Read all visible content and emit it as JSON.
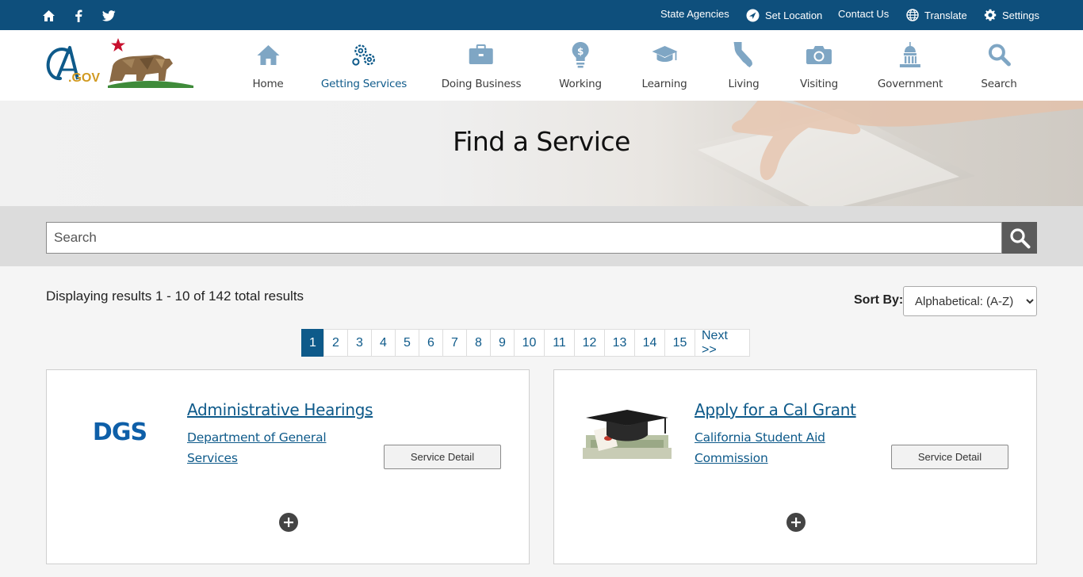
{
  "utility": {
    "links": {
      "state_agencies": "State Agencies",
      "set_location": "Set Location",
      "contact_us": "Contact Us",
      "translate": "Translate",
      "settings": "Settings"
    }
  },
  "logo": {
    "text": "CA.GOV"
  },
  "nav": {
    "home": "Home",
    "getting_services": "Getting Services",
    "doing_business": "Doing Business",
    "working": "Working",
    "learning": "Learning",
    "living": "Living",
    "visiting": "Visiting",
    "government": "Government",
    "search": "Search",
    "active_color": "#0e5a8a",
    "icon_color": "#7fa6c4"
  },
  "hero": {
    "title": "Find a Service"
  },
  "search": {
    "placeholder": "Search"
  },
  "results": {
    "summary": "Displaying results 1 - 10 of 142 total results",
    "sort_label": "Sort By:",
    "sort_selected": "Alphabetical: (A-Z)"
  },
  "pagination": {
    "pages": [
      "1",
      "2",
      "3",
      "4",
      "5",
      "6",
      "7",
      "8",
      "9",
      "10",
      "11",
      "12",
      "13",
      "14",
      "15"
    ],
    "next": "Next >>",
    "current": "1"
  },
  "cards": [
    {
      "title": "Administrative Hearings",
      "department": "Department of General Services",
      "button": "Service Detail",
      "logo_text": "DGS"
    },
    {
      "title": "Apply for a Cal Grant",
      "department": "California Student Aid Commission",
      "button": "Service Detail"
    }
  ],
  "colors": {
    "utility_bar": "#0e4f7c",
    "link": "#0e5a8a",
    "search_button": "#5b5b5b"
  }
}
